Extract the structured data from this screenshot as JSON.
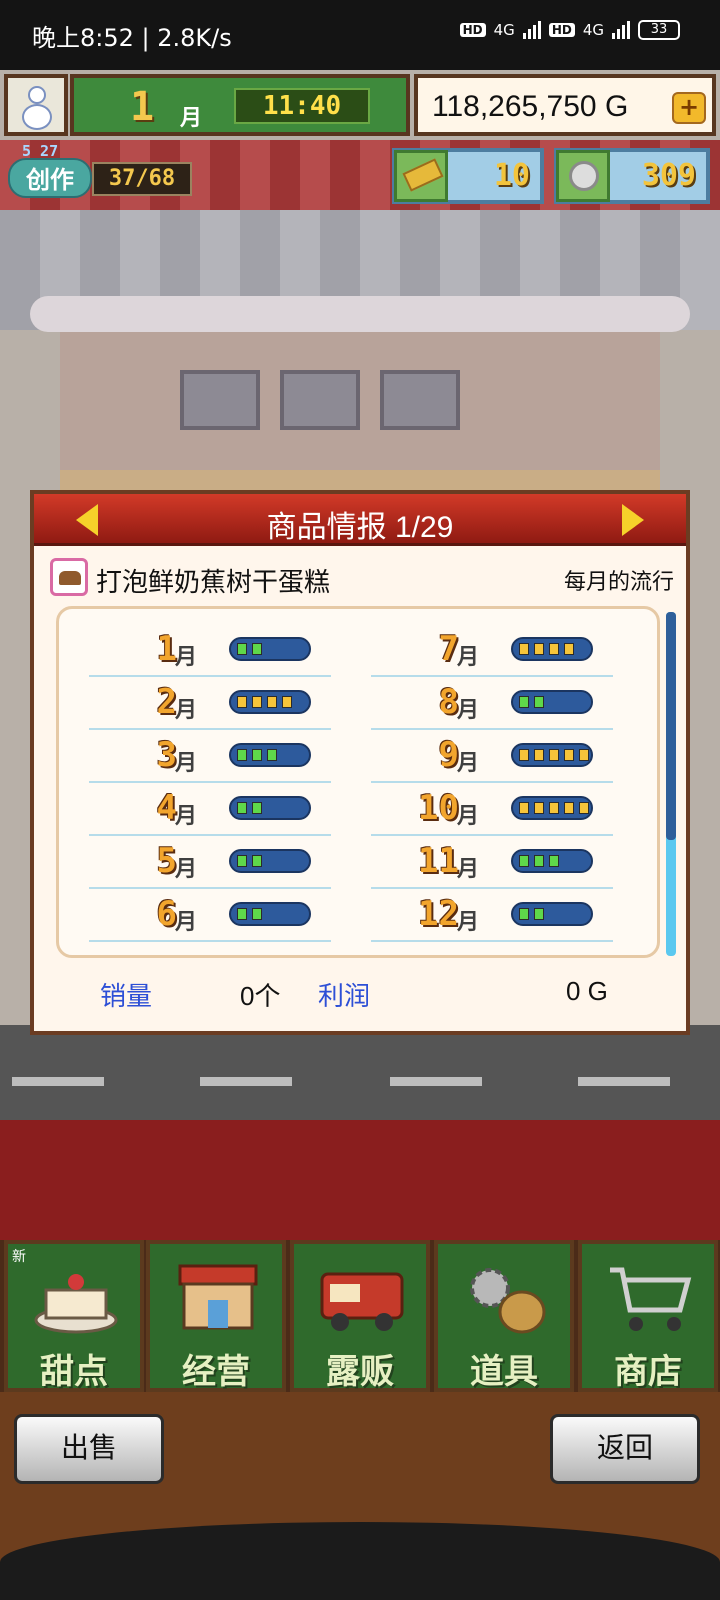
{
  "status_bar": {
    "left_text": "晚上8:52 | 2.8K/s",
    "sim1": "HD",
    "net1": "4G",
    "sim2": "HD",
    "net2": "4G",
    "battery": "33"
  },
  "hud": {
    "month_number": "1",
    "month_label": "月",
    "clock": "11:40",
    "money": "118,265,750 G",
    "add_button": "+",
    "create": {
      "version": "5 27",
      "label": "创作",
      "count": "37/68"
    },
    "tickets": "10",
    "medals": "309"
  },
  "dialog": {
    "title": "商品情报 1/29",
    "product_name": "打泡鲜奶蕉树干蛋糕",
    "trend_label": "每月的流行",
    "month_unit": "月",
    "months": [
      {
        "month": "1",
        "level": 2
      },
      {
        "month": "2",
        "level": 4
      },
      {
        "month": "3",
        "level": 3
      },
      {
        "month": "4",
        "level": 2
      },
      {
        "month": "5",
        "level": 2
      },
      {
        "month": "6",
        "level": 2
      },
      {
        "month": "7",
        "level": 4
      },
      {
        "month": "8",
        "level": 2
      },
      {
        "month": "9",
        "level": 5
      },
      {
        "month": "10",
        "level": 5
      },
      {
        "month": "11",
        "level": 3
      },
      {
        "month": "12",
        "level": 2
      }
    ],
    "sales_label": "销量",
    "sales_value": "0个",
    "profit_label": "利润",
    "profit_value": "0 G"
  },
  "menu": [
    {
      "label": "甜点",
      "icon": "cake-icon",
      "badge": "新"
    },
    {
      "label": "经营",
      "icon": "shop-building-icon"
    },
    {
      "label": "露贩",
      "icon": "food-truck-icon"
    },
    {
      "label": "道具",
      "icon": "gear-sack-icon"
    },
    {
      "label": "商店",
      "icon": "shopping-cart-icon"
    }
  ],
  "actions": {
    "sell": "出售",
    "back": "返回"
  }
}
